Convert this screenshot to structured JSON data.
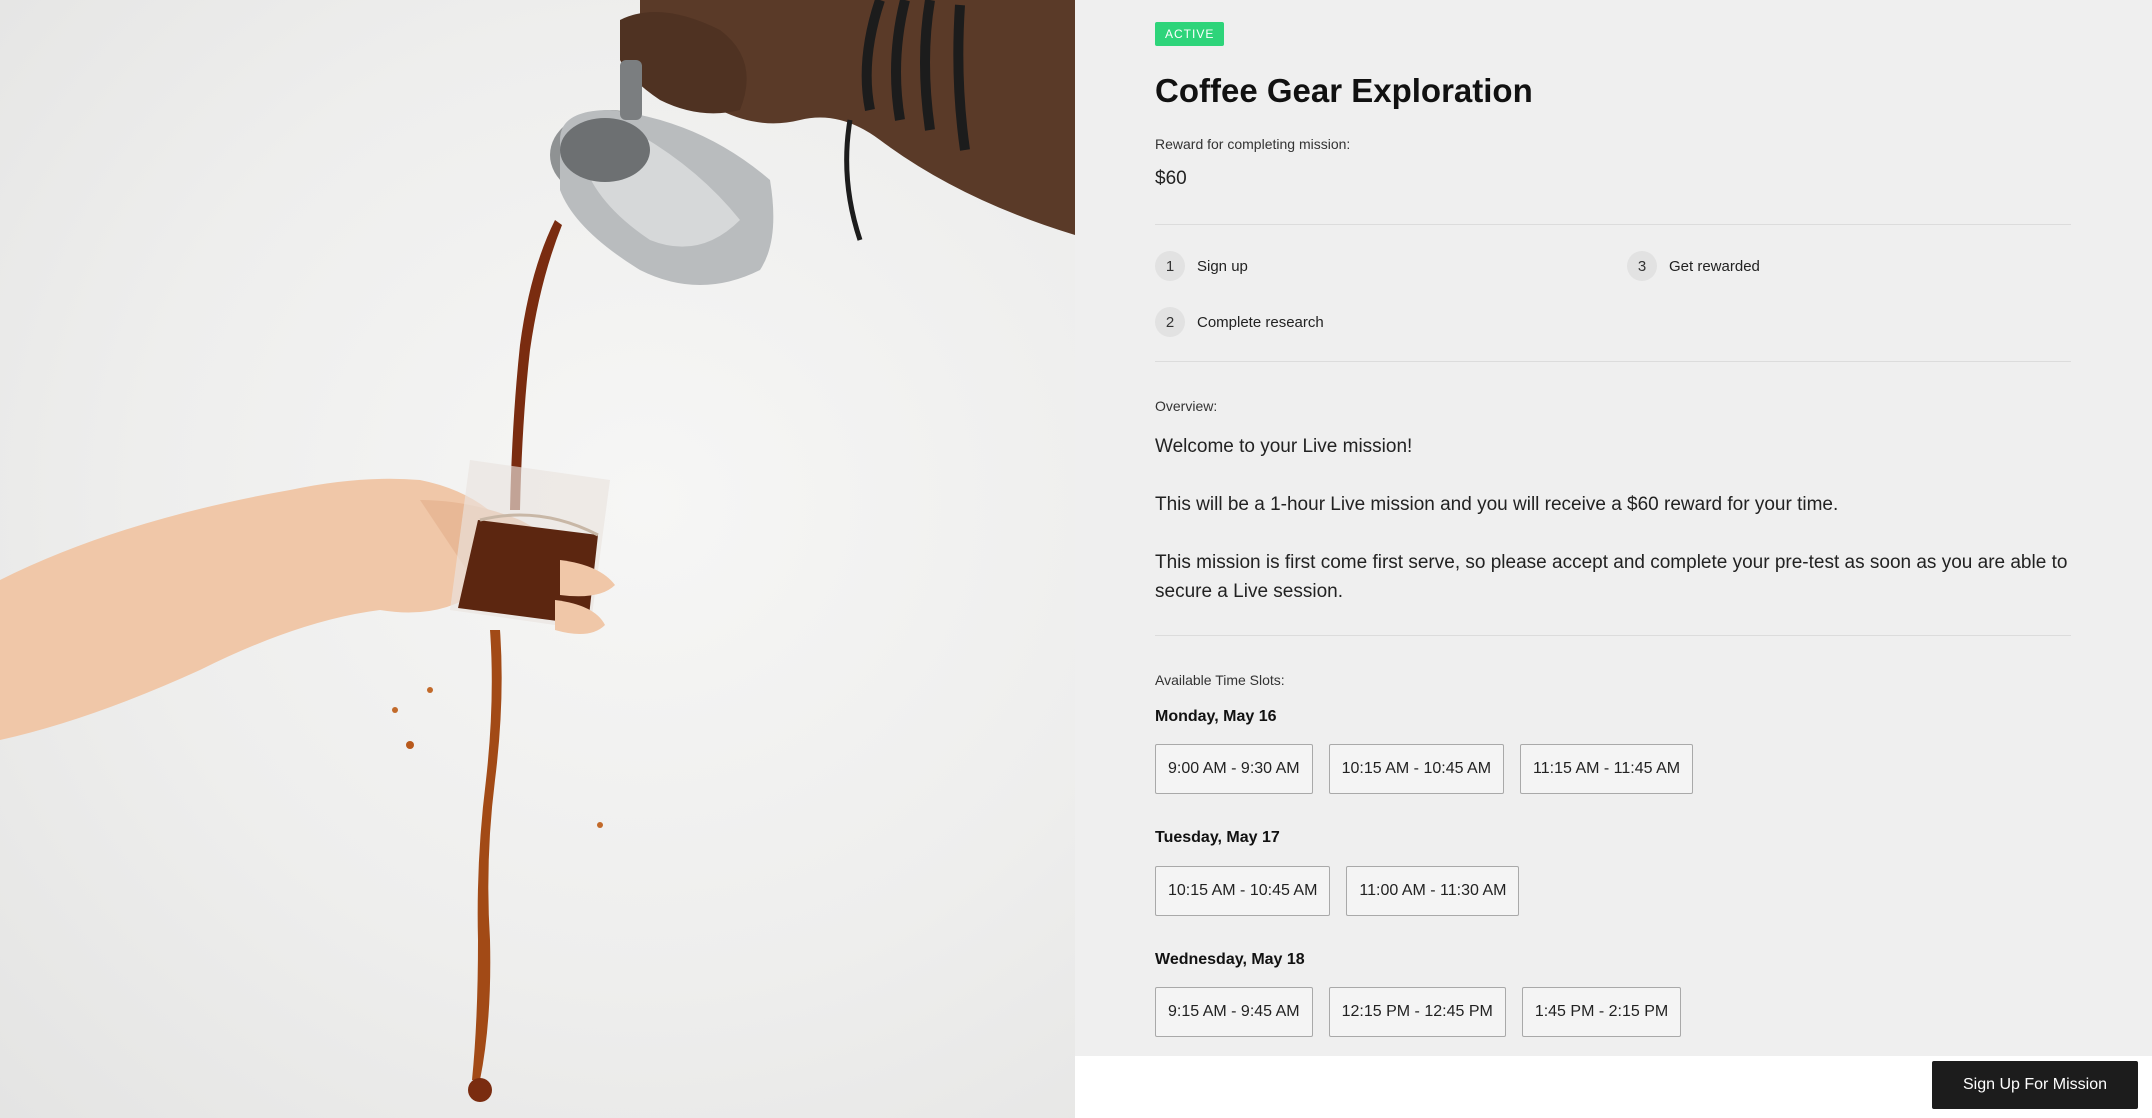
{
  "photo": {
    "alt": "coffee-pour-photo"
  },
  "mission": {
    "status": "ACTIVE",
    "title": "Coffee Gear Exploration",
    "reward_label": "Reward for completing mission:",
    "reward_value": "$60"
  },
  "steps": [
    {
      "num": "1",
      "label": "Sign up"
    },
    {
      "num": "2",
      "label": "Complete research"
    },
    {
      "num": "3",
      "label": "Get rewarded"
    }
  ],
  "overview": {
    "label": "Overview:",
    "paragraphs": [
      "Welcome to your Live mission!",
      "This will be a 1-hour Live mission and you will receive a $60 reward for your time.",
      "This mission is first come first serve, so please accept and complete your pre-test as soon as you are able to secure a Live session."
    ]
  },
  "time_slots": {
    "label": "Available Time Slots:",
    "days": [
      {
        "day": "Monday, May 16",
        "slots": [
          "9:00 AM - 9:30 AM",
          "10:15 AM - 10:45 AM",
          "11:15 AM - 11:45 AM"
        ]
      },
      {
        "day": "Tuesday, May 17",
        "slots": [
          "10:15 AM - 10:45 AM",
          "11:00 AM - 11:30 AM"
        ]
      },
      {
        "day": "Wednesday, May 18",
        "slots": [
          "9:15 AM - 9:45 AM",
          "12:15 PM - 12:45 PM",
          "1:45 PM - 2:15 PM"
        ]
      }
    ]
  },
  "footer": {
    "cta_label": "Sign Up For Mission"
  },
  "colors": {
    "badge": "#2ed47a",
    "cta": "#1c1c1c",
    "panel_bg": "#efefef"
  }
}
